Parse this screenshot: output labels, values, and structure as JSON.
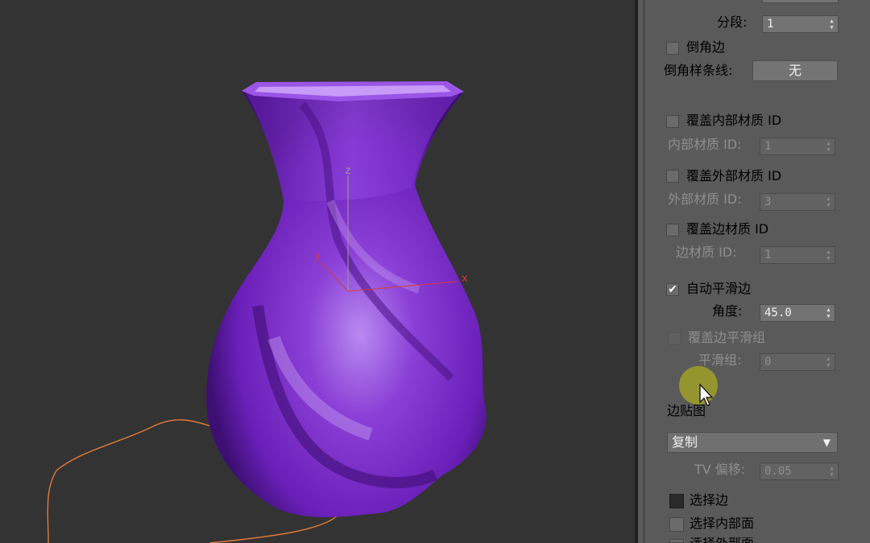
{
  "viewport": {
    "axes": {
      "x": "x",
      "y": "y",
      "z": "z"
    },
    "colors": {
      "background": "#333333",
      "vase": "#7b2bc8",
      "spline": "#e07a3a",
      "axis_x": "#d43b3b",
      "axis_y": "#d43b3b",
      "axis_z": "#9a9a9a"
    }
  },
  "panel": {
    "segments": {
      "label": "分段:",
      "value": "1"
    },
    "bevel_edge": {
      "label": "倒角边",
      "checked": false
    },
    "bevel_spline": {
      "label": "倒角样条线:",
      "button": "无"
    },
    "override_inner_mat": {
      "label": "覆盖内部材质 ID",
      "checked": false
    },
    "inner_mat_id": {
      "label": "内部材质 ID:",
      "value": "1"
    },
    "override_outer_mat": {
      "label": "覆盖外部材质 ID",
      "checked": false
    },
    "outer_mat_id": {
      "label": "外部材质 ID:",
      "value": "3"
    },
    "override_edge_mat": {
      "label": "覆盖边材质 ID",
      "checked": false
    },
    "edge_mat_id": {
      "label": "边材质 ID:",
      "value": "1"
    },
    "auto_smooth": {
      "label": "自动平滑边",
      "checked": true,
      "check_glyph": "✔"
    },
    "angle": {
      "label": "角度:",
      "value": "45.0"
    },
    "override_smooth_group": {
      "label": "覆盖边平滑组",
      "checked": false
    },
    "smooth_group": {
      "label": "平滑组:",
      "value": "0"
    },
    "edge_mapping": {
      "title": "边贴图",
      "selected": "复制",
      "arrow": "▼"
    },
    "tv_offset": {
      "label": "TV 偏移:",
      "value": "0.05"
    },
    "select_edges": {
      "label": "选择边"
    },
    "select_inner": {
      "label": "选择内部面"
    },
    "select_outer": {
      "label": "选择外部面"
    },
    "spin_up": "▲",
    "spin_down": "▼"
  }
}
